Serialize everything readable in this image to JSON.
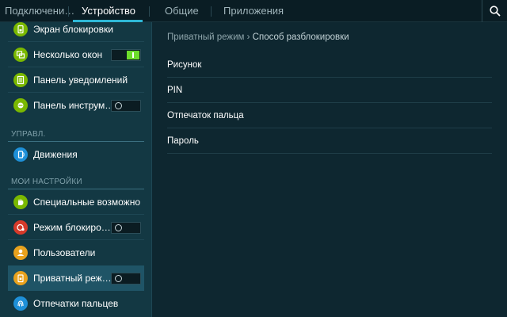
{
  "tabs": [
    {
      "label": "Подключени…",
      "active": false
    },
    {
      "label": "Устройство",
      "active": true
    },
    {
      "label": "Общие",
      "active": false
    },
    {
      "label": "Приложения",
      "active": false
    }
  ],
  "search_icon": "search-icon",
  "sidebar": {
    "items_top": [
      {
        "label": "Экран блокировки",
        "icon": "lockscreen-icon",
        "color": "#7ab800"
      },
      {
        "label": "Несколько окон",
        "icon": "multiwindow-icon",
        "color": "#7ab800",
        "toggle": "on"
      },
      {
        "label": "Панель уведомлений",
        "icon": "notification-panel-icon",
        "color": "#7ab800"
      },
      {
        "label": "Панель инструм…",
        "icon": "toolbox-icon",
        "color": "#7ab800",
        "toggle": "off"
      }
    ],
    "section_control": "УПРАВЛ.",
    "items_control": [
      {
        "label": "Движения",
        "icon": "motion-icon",
        "color": "#1e90d8"
      }
    ],
    "section_my": "МОИ НАСТРОЙКИ",
    "items_my": [
      {
        "label": "Специальные возможно…",
        "icon": "accessibility-icon",
        "color": "#7ab800"
      },
      {
        "label": "Режим блокиро…",
        "icon": "blocking-mode-icon",
        "color": "#d63a2a",
        "toggle": "off"
      },
      {
        "label": "Пользователи",
        "icon": "users-icon",
        "color": "#e8a21e"
      },
      {
        "label": "Приватный реж…",
        "icon": "private-mode-icon",
        "color": "#e8a21e",
        "toggle": "off",
        "selected": true
      },
      {
        "label": "Отпечатки пальцев",
        "icon": "fingerprint-icon",
        "color": "#1e90d8"
      }
    ]
  },
  "main": {
    "breadcrumb_parent": "Приватный режим",
    "breadcrumb_separator": "›",
    "breadcrumb_current": "Способ разблокировки",
    "options": [
      "Рисунок",
      "PIN",
      "Отпечаток пальца",
      "Пароль"
    ]
  },
  "colors": {
    "accent": "#2eb8d6",
    "toggle_on": "#6ddc2b",
    "sidebar_bg": "#133843",
    "main_bg": "#0e2730"
  }
}
